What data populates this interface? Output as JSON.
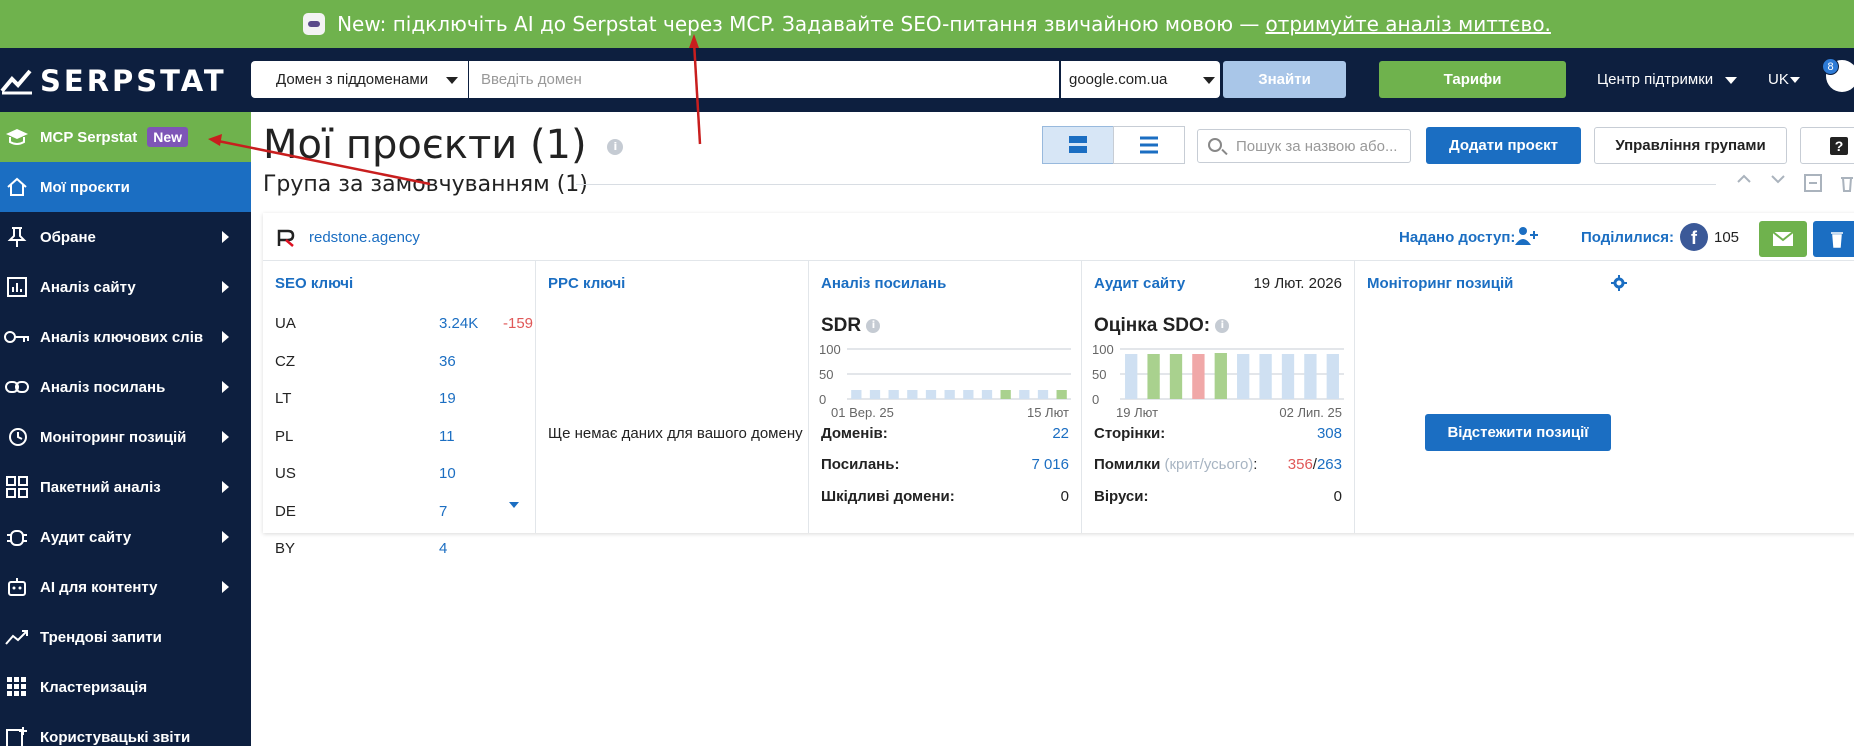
{
  "banner": {
    "text": "New: підключіть AI до Serpstat через MCP. Задавайте SEO-питання звичайною мовою —",
    "link": " отримуйте аналіз миттєво."
  },
  "header": {
    "logo": "SERPSTAT",
    "domain_mode": "Домен з піддоменами",
    "domain_placeholder": "Введіть домен",
    "engine": "google.com.ua",
    "find": "Знайти",
    "tariffs": "Тарифи",
    "support": "Центр підтримки",
    "lang": "UK",
    "notif_count": "8"
  },
  "sidebar": {
    "items": [
      {
        "label": "MCP Serpstat",
        "tag": "New"
      },
      {
        "label": "Мої проєкти"
      },
      {
        "label": "Обране"
      },
      {
        "label": "Аналіз сайту"
      },
      {
        "label": "Аналіз ключових слів"
      },
      {
        "label": "Аналіз посилань"
      },
      {
        "label": "Моніторинг позицій"
      },
      {
        "label": "Пакетний аналіз"
      },
      {
        "label": "Аудит сайту"
      },
      {
        "label": "AI для контенту"
      },
      {
        "label": "Трендові запити"
      },
      {
        "label": "Кластеризація"
      },
      {
        "label": "Користувацькі звіти"
      }
    ]
  },
  "page": {
    "title": "Мої проєкти (1)",
    "search_placeholder": "Пошук за назвою або...",
    "add_project": "Додати проєкт",
    "manage_groups": "Управління групами",
    "help": "?",
    "group_title": "Група за замовчуванням (1)"
  },
  "project": {
    "domain": "redstone.agency",
    "access_label": "Надано доступ:",
    "shared_label": "Поділилися:",
    "fb_count": "105"
  },
  "seo": {
    "title": "SEO ключі",
    "rows": [
      {
        "country": "UA",
        "value": "3.24K",
        "delta": "-159"
      },
      {
        "country": "CZ",
        "value": "36",
        "delta": ""
      },
      {
        "country": "LT",
        "value": "19",
        "delta": ""
      },
      {
        "country": "PL",
        "value": "11",
        "delta": ""
      },
      {
        "country": "US",
        "value": "10",
        "delta": ""
      },
      {
        "country": "DE",
        "value": "7",
        "delta": ""
      },
      {
        "country": "BY",
        "value": "4",
        "delta": ""
      }
    ]
  },
  "ppc": {
    "title": "PPC ключі",
    "empty": "Ще немає даних для вашого домену"
  },
  "links": {
    "title": "Аналіз посилань",
    "metric": "SDR",
    "x_start": "01 Вер. 25",
    "x_end": "15 Лют",
    "domains_label": "Доменів:",
    "domains_value": "22",
    "links_label": "Посилань:",
    "links_value": "7 016",
    "malicious_label": "Шкідливі домени:",
    "malicious_value": "0"
  },
  "audit": {
    "title": "Аудит сайту",
    "date": "19 Лют. 2026",
    "metric": "Оцінка SDO:",
    "x_start": "19 Лют",
    "x_end": "02 Лип. 25",
    "pages_label": "Сторінки:",
    "pages_value": "308",
    "errors_label": "Помилки",
    "errors_sub": "(крит/усього)",
    "errors_colon": ":",
    "errors_crit": "356",
    "errors_sep": "/",
    "errors_total": "263",
    "viruses_label": "Віруси:",
    "viruses_value": "0"
  },
  "monitoring": {
    "title": "Моніторинг позицій",
    "track": "Відстежити позиції"
  },
  "chart_data": [
    {
      "type": "bar",
      "title": "SDR",
      "ylim": [
        0,
        100
      ],
      "y_ticks": [
        "100",
        "50",
        "0"
      ],
      "x_labels": [
        "01 Вер. 25",
        "15 Лют"
      ],
      "values": [
        18,
        18,
        18,
        18,
        18,
        18,
        18,
        18,
        18,
        18,
        18,
        18
      ],
      "bar_colors": [
        "#cfe0f2",
        "#cfe0f2",
        "#cfe0f2",
        "#cfe0f2",
        "#cfe0f2",
        "#cfe0f2",
        "#cfe0f2",
        "#cfe0f2",
        "#a9d18e",
        "#cfe0f2",
        "#cfe0f2",
        "#a9d18e"
      ]
    },
    {
      "type": "bar",
      "title": "Оцінка SDO:",
      "ylim": [
        0,
        100
      ],
      "y_ticks": [
        "100",
        "50",
        "0"
      ],
      "x_labels": [
        "19 Лют",
        "02 Лип. 25"
      ],
      "values": [
        90,
        90,
        90,
        90,
        92,
        90,
        90,
        90,
        90,
        90
      ],
      "bar_colors": [
        "#cfe0f2",
        "#a9d18e",
        "#a9d18e",
        "#f0a8a8",
        "#a9d18e",
        "#cfe0f2",
        "#cfe0f2",
        "#cfe0f2",
        "#cfe0f2",
        "#cfe0f2"
      ]
    }
  ]
}
